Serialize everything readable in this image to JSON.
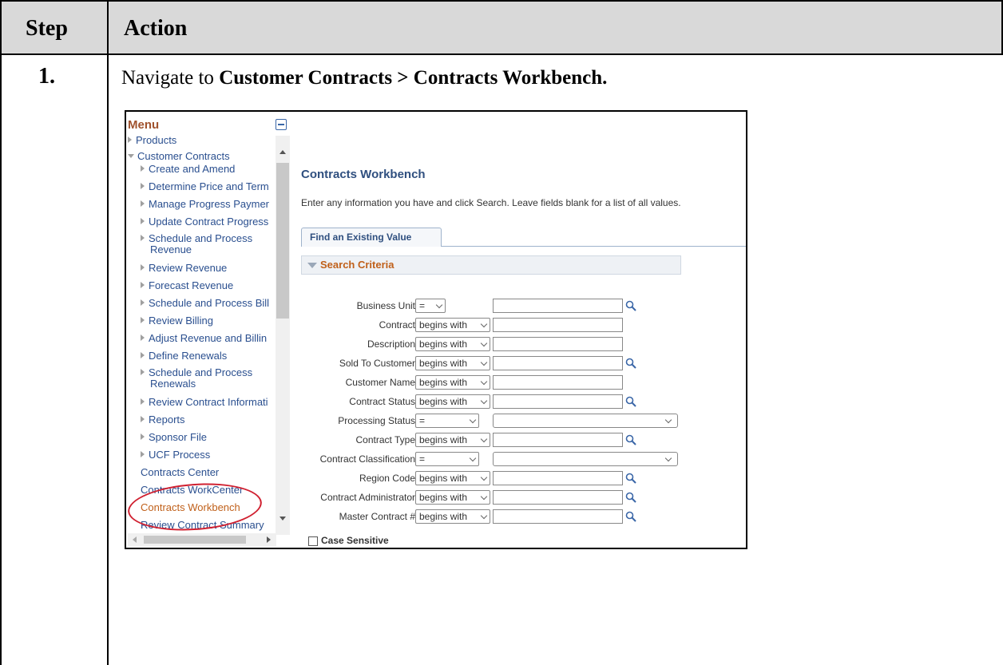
{
  "table": {
    "header_step": "Step",
    "header_action": "Action",
    "step_number": "1.",
    "instruction_prefix": "Navigate to ",
    "instruction_bold": "Customer Contracts > Contracts Workbench."
  },
  "menu": {
    "title": "Menu",
    "items": [
      {
        "label": "Products",
        "kind": "collapsed"
      },
      {
        "label": "Customer Contracts",
        "kind": "expanded"
      },
      {
        "label": "Create and Amend",
        "kind": "sub"
      },
      {
        "label": "Determine Price and Term",
        "kind": "sub"
      },
      {
        "label": "Manage Progress Paymer",
        "kind": "sub"
      },
      {
        "label": "Update Contract Progress",
        "kind": "sub"
      },
      {
        "label": "Schedule and Process Revenue",
        "kind": "sub"
      },
      {
        "label": "Review Revenue",
        "kind": "sub"
      },
      {
        "label": "Forecast Revenue",
        "kind": "sub"
      },
      {
        "label": "Schedule and Process Bill",
        "kind": "sub"
      },
      {
        "label": "Review Billing",
        "kind": "sub"
      },
      {
        "label": "Adjust Revenue and Billin",
        "kind": "sub"
      },
      {
        "label": "Define Renewals",
        "kind": "sub"
      },
      {
        "label": "Schedule and Process Renewals",
        "kind": "sub"
      },
      {
        "label": "Review Contract Informati",
        "kind": "sub"
      },
      {
        "label": "Reports",
        "kind": "sub"
      },
      {
        "label": "Sponsor File",
        "kind": "sub"
      },
      {
        "label": "UCF Process",
        "kind": "sub"
      },
      {
        "label": "Contracts Center",
        "kind": "leaf"
      },
      {
        "label": "Contracts WorkCenter",
        "kind": "leaf"
      },
      {
        "label": "Contracts Workbench",
        "kind": "leaf-active"
      },
      {
        "label": "Review Contract Summary",
        "kind": "leaf"
      }
    ]
  },
  "page": {
    "title": "Contracts Workbench",
    "instructions": "Enter any information you have and click Search. Leave fields blank for a list of all values.",
    "tab_label": "Find an Existing Value",
    "section_label": "Search Criteria",
    "fields": [
      {
        "label": "Business Unit",
        "operator": "=",
        "lookup": true,
        "wide": false
      },
      {
        "label": "Contract",
        "operator": "begins with",
        "lookup": false,
        "wide": false
      },
      {
        "label": "Description",
        "operator": "begins with",
        "lookup": false,
        "wide": false
      },
      {
        "label": "Sold To Customer",
        "operator": "begins with",
        "lookup": true,
        "wide": false
      },
      {
        "label": "Customer Name",
        "operator": "begins with",
        "lookup": false,
        "wide": false
      },
      {
        "label": "Contract Status",
        "operator": "begins with",
        "lookup": true,
        "wide": false
      },
      {
        "label": "Processing Status",
        "operator": "=",
        "lookup": false,
        "wide": true
      },
      {
        "label": "Contract Type",
        "operator": "begins with",
        "lookup": true,
        "wide": false
      },
      {
        "label": "Contract Classification",
        "operator": "=",
        "lookup": false,
        "wide": true
      },
      {
        "label": "Region Code",
        "operator": "begins with",
        "lookup": true,
        "wide": false
      },
      {
        "label": "Contract Administrator",
        "operator": "begins with",
        "lookup": true,
        "wide": false
      },
      {
        "label": "Master Contract #",
        "operator": "begins with",
        "lookup": true,
        "wide": false
      }
    ],
    "case_sensitive_label": "Case Sensitive"
  },
  "colors": {
    "menu_link": "#2a4f8f",
    "menu_active": "#c0601a",
    "highlight_circle": "#d02030",
    "header_fill": "#d9d9d9"
  }
}
